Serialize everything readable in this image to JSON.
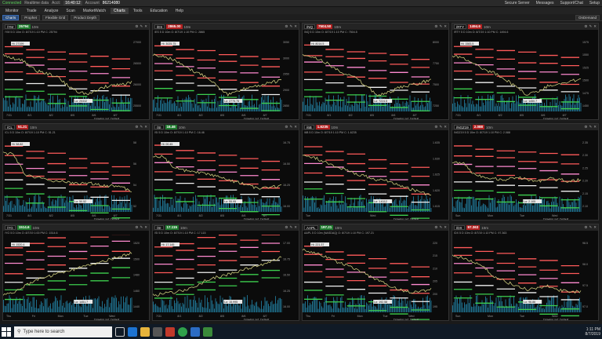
{
  "topbar": {
    "connected": "Connected",
    "status": "Realtime data",
    "account_label": "Acct:",
    "account_value": "86214080",
    "account_tag": "Account",
    "time": "16:40:12",
    "right_items": [
      "Secure Server",
      "Messages",
      "Support/Chat",
      "Setup"
    ]
  },
  "menu": [
    "Monitor",
    "Trade",
    "Analyze",
    "Scan",
    "MarketWatch",
    "Charts",
    "Tools",
    "Education",
    "Help"
  ],
  "menu_active": "Charts",
  "toolbar": {
    "charts_label": "Charts",
    "flexible_grid": "Flexible Grid",
    "prophet": "Prophet",
    "product_depth": "Product Depth",
    "ondemand": "OnDemand"
  },
  "panels": [
    {
      "symbol": "/YM",
      "price": "25794",
      "dir": "up",
      "tf": "10m",
      "sub": "/YM 5 D 10m  O: 8/7/19 1:10 PM  C: 25794",
      "hi": "Hi: 27199",
      "lo": "Lo: 25332",
      "xlabels": [
        "7/31",
        "8/1",
        "8/2",
        "8/5",
        "8/6",
        "8/7"
      ],
      "ylabels": [
        "27000",
        "26500",
        "26000",
        "25500"
      ],
      "drawing": "Drawing set: Default",
      "trend": [
        0.2,
        0.25,
        0.3,
        0.45,
        0.5,
        0.55,
        0.7,
        0.8,
        0.85,
        0.75,
        0.7,
        0.68,
        0.65
      ],
      "colors": [
        "#ff5a5a",
        "#ff5a5a",
        "#ff8ad0",
        "#ff5a5a",
        "#f0f0f0",
        "#3ccf4e",
        "#3ccf4e"
      ]
    },
    {
      "symbol": "/ES",
      "price": "2865.00",
      "dir": "dn",
      "tf": "10m",
      "sub": "/ES 5 D 10m  O: 8/7/19 1:10 PM  C: 2865",
      "hi": "Hi: 3025.75",
      "lo": "Lo: 2775.75",
      "xlabels": [
        "7/31",
        "8/1",
        "8/2",
        "8/5",
        "8/6",
        "8/7"
      ],
      "ylabels": [
        "3050",
        "3000",
        "2950",
        "2900",
        "2850"
      ],
      "drawing": "Drawing set: Default",
      "trend": [
        0.2,
        0.22,
        0.28,
        0.4,
        0.48,
        0.55,
        0.7,
        0.85,
        0.8,
        0.72,
        0.7,
        0.65,
        0.62
      ],
      "colors": [
        "#ff5a5a",
        "#ff5a5a",
        "#ff8ad0",
        "#ff5a5a",
        "#f0f0f0",
        "#3ccf4e",
        "#3ccf4e"
      ]
    },
    {
      "symbol": "/NQ",
      "price": "7504.50",
      "dir": "dn",
      "tf": "10m",
      "sub": "/NQ 5 D 10m  O: 8/7/19 1:10 PM  C: 7504.5",
      "hi": "Hi: 8014.5",
      "lo": "Lo: 7224.5",
      "xlabels": [
        "7/31",
        "8/1",
        "8/2",
        "8/5",
        "8/6",
        "8/7"
      ],
      "ylabels": [
        "8000",
        "7750",
        "7500",
        "7250"
      ],
      "drawing": "Drawing set: Default",
      "trend": [
        0.2,
        0.24,
        0.3,
        0.42,
        0.5,
        0.58,
        0.72,
        0.86,
        0.82,
        0.74,
        0.7,
        0.66,
        0.6
      ],
      "colors": [
        "#ff5a5a",
        "#ff5a5a",
        "#ff8ad0",
        "#ff5a5a",
        "#f0f0f0",
        "#3ccf4e",
        "#3ccf4e"
      ]
    },
    {
      "symbol": "/RTY",
      "price": "1494.6",
      "dir": "dn",
      "tf": "10m",
      "sub": "/RTY 5 D 10m  O: 8/7/19 1:10 PM  C: 1494.6",
      "hi": "Hi: 1583.5",
      "lo": "Lo: 1450.7",
      "xlabels": [
        "7/31",
        "8/1",
        "8/2",
        "8/5",
        "8/6",
        "8/7"
      ],
      "ylabels": [
        "1575",
        "1550",
        "1525",
        "1500",
        "1475",
        "1450"
      ],
      "drawing": "Drawing set: Default",
      "trend": [
        0.2,
        0.25,
        0.32,
        0.45,
        0.5,
        0.6,
        0.74,
        0.85,
        0.8,
        0.7,
        0.68,
        0.64,
        0.58
      ],
      "colors": [
        "#ff5a5a",
        "#ff5a5a",
        "#ff8ad0",
        "#ff5a5a",
        "#f0f0f0",
        "#3ccf4e",
        "#3ccf4e"
      ]
    },
    {
      "symbol": "/CL",
      "price": "51.21",
      "dir": "dn",
      "tf": "10m",
      "sub": "/CL 5 D 10m  O: 8/7/19 1:10 PM  C: 51.21",
      "hi": "Hi: 58.82",
      "lo": "Lo: 50.52",
      "xlabels": [
        "7/31",
        "8/1",
        "8/2",
        "8/5",
        "8/6",
        "8/7"
      ],
      "ylabels": [
        "58",
        "56",
        "54",
        "52"
      ],
      "drawing": "Drawing set: Default",
      "trend": [
        0.15,
        0.18,
        0.5,
        0.55,
        0.6,
        0.62,
        0.64,
        0.66,
        0.65,
        0.68,
        0.7,
        0.72,
        0.78
      ],
      "colors": [
        "#ff5a5a",
        "#ff5a5a",
        "#ff8ad0",
        "#ff5a5a",
        "#f0f0f0",
        "#3ccf4e",
        "#3ccf4e"
      ]
    },
    {
      "symbol": "/SI",
      "price": "16.46",
      "dir": "up",
      "tf": "10m",
      "sub": "/SI 5 D 10m  O: 8/7/19 1:10 PM  C: 16.46",
      "hi": "Hi: 00.45",
      "lo": "Lo: 55.95",
      "xlabels": [
        "7/31",
        "8/1",
        "8/2",
        "8/5",
        "8/6",
        "8/7"
      ],
      "ylabels": [
        "16.75",
        "16.50",
        "16.25",
        "16.00"
      ],
      "drawing": "Drawing set: Default",
      "trend": [
        0.2,
        0.22,
        0.4,
        0.45,
        0.48,
        0.5,
        0.55,
        0.6,
        0.64,
        0.7,
        0.75,
        0.72,
        0.7
      ],
      "colors": [
        "#ff5a5a",
        "#ff5a5a",
        "#ff8ad0",
        "#ff5a5a",
        "#f0f0f0",
        "#3ccf4e",
        "#3ccf4e"
      ]
    },
    {
      "symbol": "/6B",
      "price": "1.6235",
      "dir": "dn",
      "tf": "10m",
      "sub": "/6B 5 D 10m  O: 8/7/19 1:10 PM  C: 1.6235",
      "hi": "",
      "lo": "Lo: 1.6112",
      "xlabels": [
        "Tue",
        "Wed"
      ],
      "ylabels": [
        "1.635",
        "1.630",
        "1.625",
        "1.620",
        "1.615"
      ],
      "drawing": "Drawing set: Default",
      "trend": [
        0.2,
        0.22,
        0.3,
        0.38,
        0.42,
        0.5,
        0.55,
        0.6,
        0.62,
        0.7,
        0.75,
        0.8,
        0.86
      ],
      "colors": [
        "#ff5a5a",
        "#ff5a5a",
        "#ff8ad0",
        "#ff5a5a",
        "#f0f0f0",
        "#3ccf4e",
        "#3ccf4e"
      ]
    },
    {
      "symbol": "/NGZ19",
      "price": "2.088",
      "dir": "dn",
      "tf": "10m",
      "sub": "/NGZ19 5 D 10m  O: 8/7/19 1:10 PM  C: 2.088",
      "hi": "",
      "lo": "Lo: 2.105",
      "xlabels": [
        "Sun",
        "Mon",
        "Tue",
        "Wed"
      ],
      "ylabels": [
        "2.35",
        "2.30",
        "2.25",
        "2.20",
        "2.15",
        "2.10"
      ],
      "drawing": "Drawing set: Default",
      "trend": [
        0.3,
        0.32,
        0.5,
        0.55,
        0.58,
        0.6,
        0.55,
        0.6,
        0.62,
        0.58,
        0.6,
        0.62,
        0.6
      ],
      "colors": [
        "#ff5a5a",
        "#ff5a5a",
        "#ff8ad0",
        "#ff5a5a",
        "#f0f0f0",
        "#3ccf4e",
        "#3ccf4e"
      ]
    },
    {
      "symbol": "/YG",
      "price": "1514.6",
      "dir": "up",
      "tf": "10m",
      "sub": "/YG 5 D 10m  O: 8/7/19 1:00 PM  C: 1514.6",
      "hi": "Hi: 1520.4",
      "lo": "Lo: 1451.7",
      "xlabels": [
        "Thu",
        "Fri",
        "Mon",
        "Tue",
        "Wed"
      ],
      "ylabels": [
        "1520",
        "1500",
        "1480",
        "1460",
        "1440"
      ],
      "drawing": "Drawing set: Default",
      "trend": [
        0.85,
        0.8,
        0.7,
        0.6,
        0.55,
        0.5,
        0.45,
        0.4,
        0.35,
        0.3,
        0.25,
        0.2,
        0.15
      ],
      "colors": [
        "#ff5a5a",
        "#ff5a5a",
        "#ff8ad0",
        "#ff5a5a",
        "#f0f0f0",
        "#3ccf4e",
        "#3ccf4e"
      ]
    },
    {
      "symbol": "/SI",
      "price": "17.115",
      "dir": "up",
      "tf": "10m",
      "sub": "/SI 5 D 10m  O: 8/7/19 1:10 PM  C: 17.115",
      "hi": "Hi: 17.145",
      "lo": "Lo: 15.995",
      "xlabels": [
        "7/31",
        "8/1",
        "8/2",
        "8/5",
        "8/6",
        "8/7"
      ],
      "ylabels": [
        "17.00",
        "16.75",
        "16.50",
        "16.25",
        "16.00"
      ],
      "drawing": "Drawing set: Default",
      "trend": [
        0.85,
        0.82,
        0.8,
        0.76,
        0.7,
        0.6,
        0.55,
        0.5,
        0.45,
        0.4,
        0.35,
        0.3,
        0.2
      ],
      "colors": [
        "#ff5a5a",
        "#ff5a5a",
        "#ff8ad0",
        "#ff5a5a",
        "#f0f0f0",
        "#3ccf4e",
        "#3ccf4e"
      ]
    },
    {
      "symbol": "AAPL",
      "price": "197.21",
      "dir": "up",
      "tf": "10m",
      "sub": "AAPL 5 D 10m (NASDAQ)  O: 8/7/19 1:10 PM  C: 197.21",
      "hi": "Hi: 221.37",
      "lo": "Lo: 192.58",
      "xlabels": [
        "Thu",
        "Fri",
        "Mon",
        "Tue",
        "Wed"
      ],
      "ylabels": [
        "220",
        "215",
        "210",
        "205",
        "200",
        "195"
      ],
      "drawing": "Drawing set: Default",
      "trend": [
        0.1,
        0.14,
        0.2,
        0.28,
        0.35,
        0.42,
        0.5,
        0.6,
        0.68,
        0.75,
        0.8,
        0.78,
        0.75
      ],
      "colors": [
        "#ff5a5a",
        "#ff5a5a",
        "#ff8ad0",
        "#ff5a5a",
        "#f0f0f0",
        "#3ccf4e",
        "#3ccf4e"
      ]
    },
    {
      "symbol": "/DX",
      "price": "97.363",
      "dir": "dn",
      "tf": "10m",
      "sub": "/DX 5 D 10m  O: 8/7/19 1:10 PM  C: 97.363",
      "hi": "",
      "lo": "Lo: 96.86",
      "xlabels": [
        "Sun",
        "Mon",
        "Tue",
        "Wed"
      ],
      "ylabels": [
        "98.5",
        "98.0",
        "97.5",
        "97.0"
      ],
      "drawing": "Drawing set: Default",
      "trend": [
        0.2,
        0.22,
        0.3,
        0.4,
        0.55,
        0.62,
        0.7,
        0.75,
        0.72,
        0.7,
        0.76,
        0.8,
        0.78
      ],
      "colors": [
        "#ff5a5a",
        "#ff5a5a",
        "#ff8ad0",
        "#ff5a5a",
        "#f0f0f0",
        "#3ccf4e",
        "#3ccf4e"
      ]
    }
  ],
  "taskbar": {
    "search_placeholder": "Type here to search",
    "time": "1:11 PM",
    "date": "8/7/2019"
  }
}
